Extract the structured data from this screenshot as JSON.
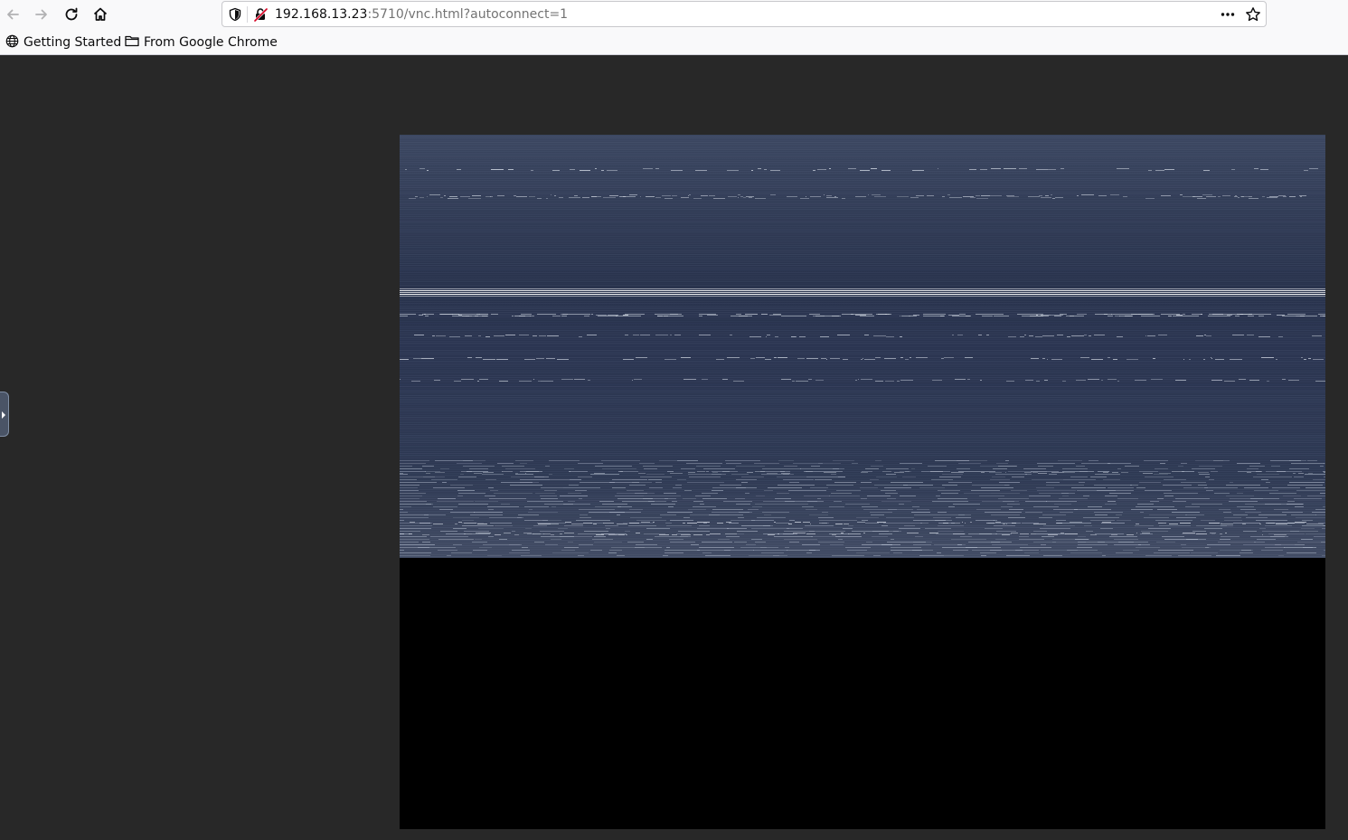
{
  "browser": {
    "url_host": "192.168.13.23",
    "url_rest": ":5710/vnc.html?autoconnect=1",
    "bookmarks": [
      {
        "label": "Getting Started",
        "icon": "globe-icon"
      },
      {
        "label": "From Google Chrome",
        "icon": "folder-icon"
      }
    ]
  },
  "vnc": {
    "state": "connected-corrupted-framebuffer",
    "framebuffer_color": "#2b3650",
    "background_color": "#282828"
  }
}
